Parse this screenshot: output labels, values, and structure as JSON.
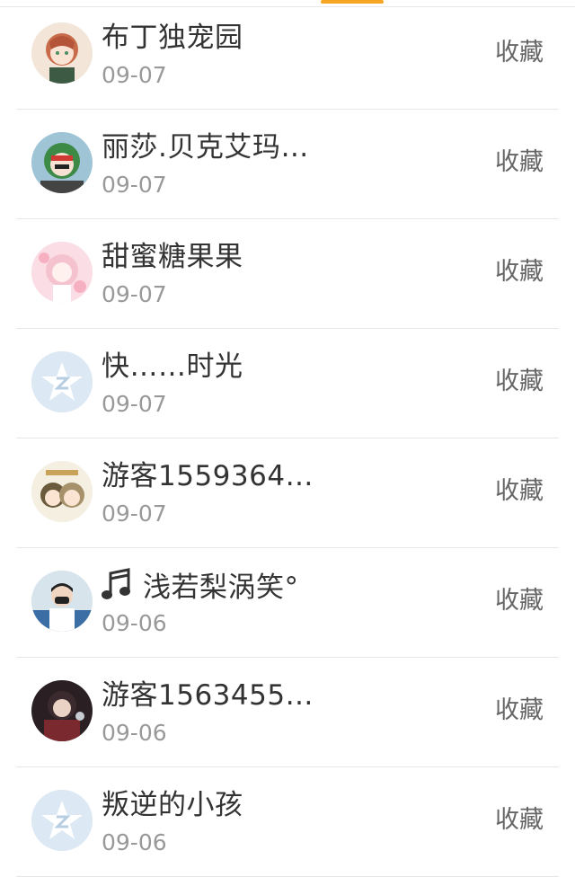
{
  "items": [
    {
      "name": "布丁独宠园",
      "date": "09-07",
      "action": "收藏",
      "avatar": "anime-girl-avatar"
    },
    {
      "name": "丽莎.贝克艾玛…",
      "date": "09-07",
      "action": "收藏",
      "avatar": "anime-character-avatar"
    },
    {
      "name": "甜蜜糖果果",
      "date": "09-07",
      "action": "收藏",
      "avatar": "pink-anime-avatar"
    },
    {
      "name": "快……时光",
      "date": "09-07",
      "action": "收藏",
      "avatar": "default-qq-avatar"
    },
    {
      "name": "游客1559364…",
      "date": "09-07",
      "action": "收藏",
      "avatar": "couple-anime-avatar"
    },
    {
      "name": "浅若梨涡笑°",
      "date": "09-06",
      "action": "收藏",
      "avatar": "masked-person-avatar",
      "prefix_icon": "music-note-icon"
    },
    {
      "name": "游客1563455…",
      "date": "09-06",
      "action": "收藏",
      "avatar": "dark-anime-avatar"
    },
    {
      "name": "叛逆的小孩",
      "date": "09-06",
      "action": "收藏",
      "avatar": "default-qq-avatar"
    }
  ],
  "colors": {
    "accent": "#f6a623",
    "name_text": "#333333",
    "date_text": "#999999",
    "action_text": "#666666",
    "divider": "#e6e6e6"
  }
}
